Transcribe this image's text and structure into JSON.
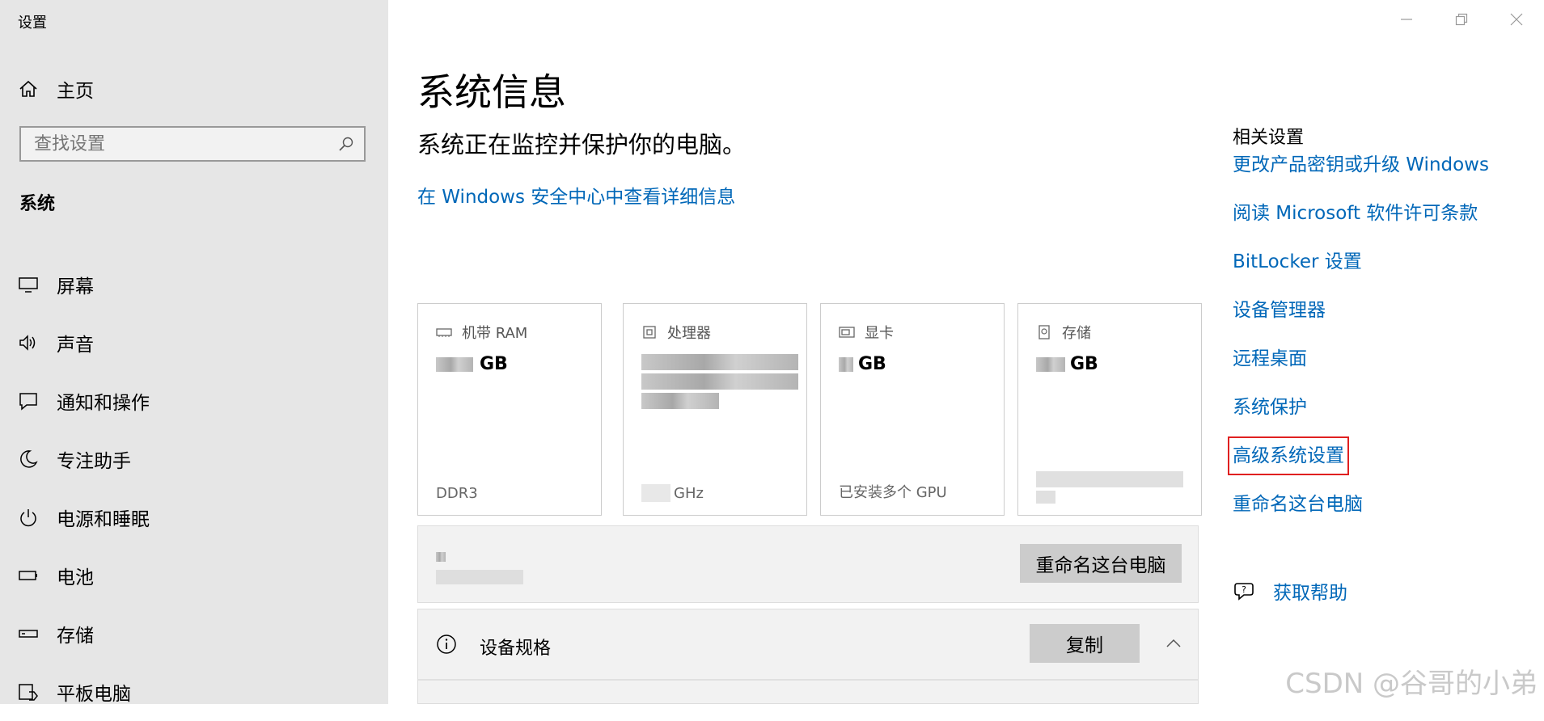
{
  "window": {
    "title": "设置"
  },
  "sidebar": {
    "home_label": "主页",
    "search_placeholder": "查找设置",
    "section_title": "系统",
    "items": [
      {
        "label": "屏幕",
        "icon": "display-icon"
      },
      {
        "label": "声音",
        "icon": "speaker-icon"
      },
      {
        "label": "通知和操作",
        "icon": "notification-icon"
      },
      {
        "label": "专注助手",
        "icon": "moon-icon"
      },
      {
        "label": "电源和睡眠",
        "icon": "power-icon"
      },
      {
        "label": "电池",
        "icon": "battery-icon"
      },
      {
        "label": "存储",
        "icon": "storage-icon"
      },
      {
        "label": "平板电脑",
        "icon": "tablet-icon"
      }
    ]
  },
  "main": {
    "title": "系统信息",
    "status": "系统正在监控并保护你的电脑。",
    "security_link": "在 Windows 安全中心中查看详细信息",
    "cards": [
      {
        "label": "机带 RAM",
        "value_suffix": "GB",
        "footer": "DDR3",
        "icon": "ram-icon"
      },
      {
        "label": "处理器",
        "value_suffix": "",
        "footer": "GHz",
        "icon": "cpu-icon"
      },
      {
        "label": "显卡",
        "value_suffix": "GB",
        "footer": "已安装多个 GPU",
        "icon": "gpu-icon"
      },
      {
        "label": "存储",
        "value_suffix": "GB",
        "footer": "",
        "icon": "disk-icon"
      }
    ],
    "rename_button": "重命名这台电脑",
    "spec_title": "设备规格",
    "copy_button": "复制"
  },
  "related": {
    "title": "相关设置",
    "links": [
      "更改产品密钥或升级 Windows",
      "阅读 Microsoft 软件许可条款",
      "BitLocker 设置",
      "设备管理器",
      "远程桌面",
      "系统保护",
      "高级系统设置",
      "重命名这台电脑"
    ],
    "help": "获取帮助"
  },
  "watermark": "CSDN @谷哥的小弟",
  "colors": {
    "accent": "#0067b8",
    "sidebar_bg": "#e6e6e6",
    "highlight": "#e02020"
  }
}
